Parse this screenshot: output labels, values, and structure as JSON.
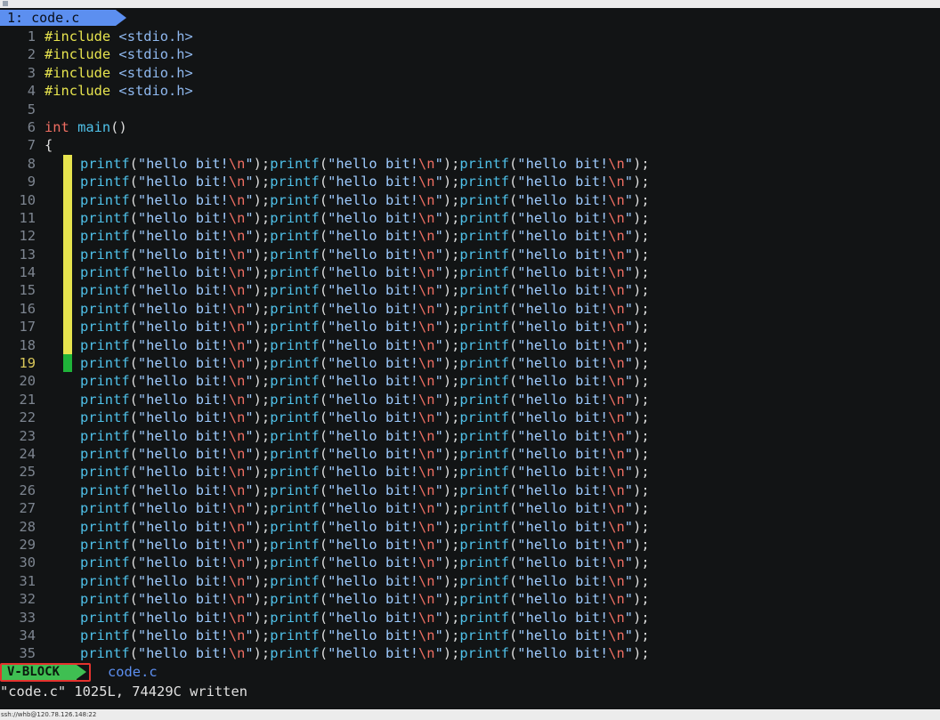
{
  "titlebar": {
    "title": ""
  },
  "tab": {
    "label": "1: code.c"
  },
  "code": {
    "header_lines": [
      {
        "num": "1",
        "pp": "#include",
        "inc": "<stdio.h>"
      },
      {
        "num": "2",
        "pp": "#include",
        "inc": "<stdio.h>"
      },
      {
        "num": "3",
        "pp": "#include",
        "inc": "<stdio.h>"
      },
      {
        "num": "4",
        "pp": "#include",
        "inc": "<stdio.h>"
      }
    ],
    "blank_line_num": "5",
    "main_line": {
      "num": "6",
      "type": "int",
      "name": "main",
      "parens": "()"
    },
    "brace_line": {
      "num": "7",
      "text": "{"
    },
    "printf_call": {
      "fn": "printf",
      "open": "(",
      "str_start": "\"hello bit!",
      "esc": "\\n",
      "str_end": "\"",
      "close": ");"
    },
    "calls_per_line": 3,
    "printf_line_nums": [
      "8",
      "9",
      "10",
      "11",
      "12",
      "13",
      "14",
      "15",
      "16",
      "17",
      "18",
      "19",
      "20",
      "21",
      "22",
      "23",
      "24",
      "25",
      "26",
      "27",
      "28",
      "29",
      "30",
      "31",
      "32",
      "33",
      "34",
      "35"
    ],
    "current_line": "19",
    "block_selection_lines": [
      "8",
      "9",
      "10",
      "11",
      "12",
      "13",
      "14",
      "15",
      "16",
      "17",
      "18",
      "19"
    ]
  },
  "status": {
    "mode": "V-BLOCK",
    "file": "code.c"
  },
  "cmdline": {
    "message": "\"code.c\" 1025L, 74429C written"
  },
  "sshbar": {
    "text": "ssh://whb@120.78.126.148:22"
  },
  "colors": {
    "background": "#121415",
    "tab": "#5c8ff0",
    "mode": "#3fbf52",
    "mode_highlight_border": "#e5322e",
    "selection_column": "#e6e34e",
    "cursor": "#1fb339"
  }
}
